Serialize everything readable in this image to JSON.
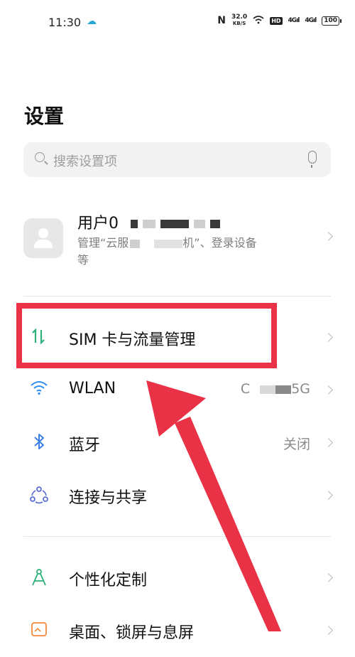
{
  "status_bar": {
    "time": "11:30",
    "nfc": "N",
    "speed": "32.0",
    "speed_unit": "KB/S",
    "hd": "HD",
    "sig1": "4Gıl",
    "sig2": "4Gıl",
    "battery": "100"
  },
  "page_title": "设置",
  "search": {
    "placeholder": "搜索设置项"
  },
  "user": {
    "name": "用户0",
    "subtitle_a": "管理“云服",
    "subtitle_b": "机”、登录设备",
    "subtitle_c": "等"
  },
  "items": [
    {
      "label": "SIM 卡与流量管理",
      "value": "",
      "icon": "sim-data-icon",
      "color": "#2eb07b"
    },
    {
      "label": "WLAN",
      "value_a": "C",
      "value_b": "5G",
      "icon": "wifi-icon",
      "color": "#2d8cf0"
    },
    {
      "label": "蓝牙",
      "value": "关闭",
      "icon": "bluetooth-icon",
      "color": "#3b7ee6"
    },
    {
      "label": "连接与共享",
      "value": "",
      "icon": "connection-share-icon",
      "color": "#5a6ed6"
    },
    {
      "label": "个性化定制",
      "value": "",
      "icon": "personalize-icon",
      "color": "#2eb07b"
    },
    {
      "label": "桌面、锁屏与息屏",
      "value": "",
      "icon": "desktop-icon",
      "color": "#f08a3c"
    }
  ],
  "colors": {
    "highlight": "#e93245",
    "arrow": "#e93245"
  }
}
